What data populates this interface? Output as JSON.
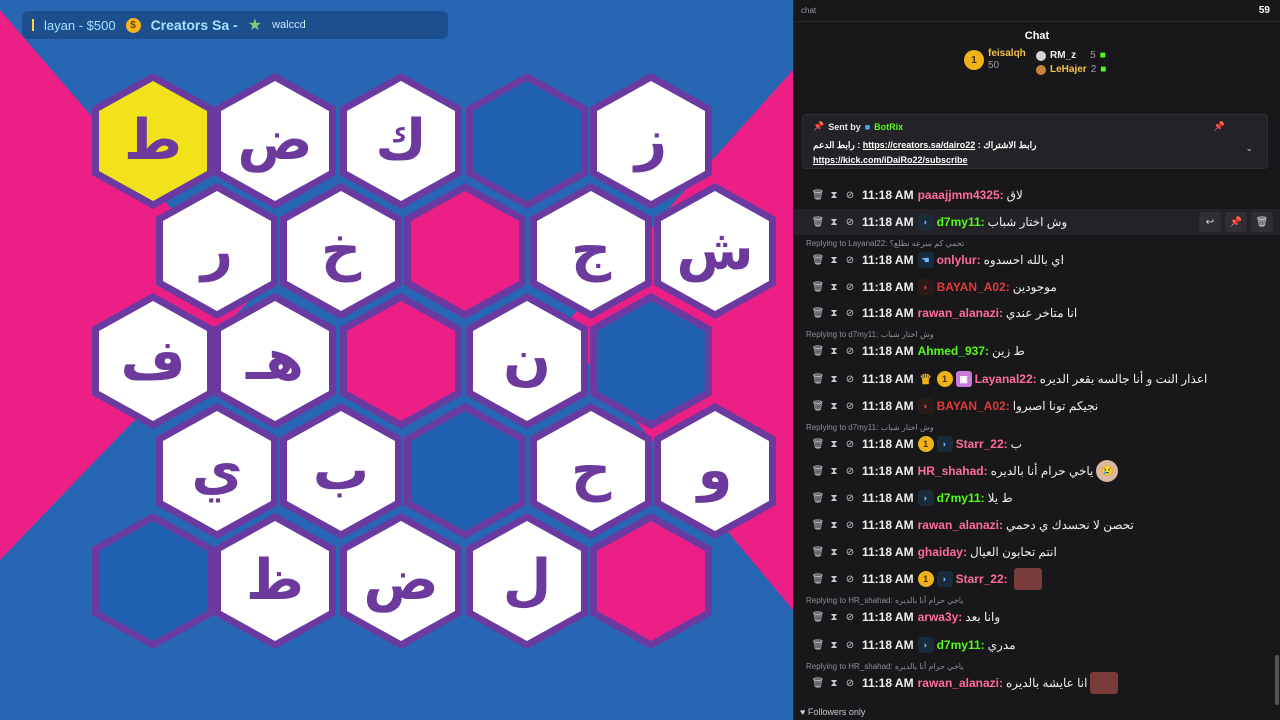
{
  "ticker": {
    "item1": "layan - $500",
    "item2": "Creators Sa -",
    "item3": "walccd",
    "coin": "$"
  },
  "board": {
    "tiles": [
      {
        "letter": "ط",
        "color": "yellow"
      },
      {
        "letter": "ض",
        "color": "white"
      },
      {
        "letter": "ك",
        "color": "white"
      },
      {
        "letter": "",
        "color": "blue"
      },
      {
        "letter": "ز",
        "color": "white"
      },
      {
        "letter": "ر",
        "color": "white"
      },
      {
        "letter": "خ",
        "color": "white"
      },
      {
        "letter": "",
        "color": "pink"
      },
      {
        "letter": "ج",
        "color": "white"
      },
      {
        "letter": "ش",
        "color": "white"
      },
      {
        "letter": "ف",
        "color": "white"
      },
      {
        "letter": "هـ",
        "color": "white"
      },
      {
        "letter": "",
        "color": "pink"
      },
      {
        "letter": "ن",
        "color": "white"
      },
      {
        "letter": "",
        "color": "blue"
      },
      {
        "letter": "ي",
        "color": "white"
      },
      {
        "letter": "ب",
        "color": "white"
      },
      {
        "letter": "",
        "color": "blue"
      },
      {
        "letter": "ح",
        "color": "white"
      },
      {
        "letter": "و",
        "color": "white"
      },
      {
        "letter": "",
        "color": "blue"
      },
      {
        "letter": "ظ",
        "color": "white"
      },
      {
        "letter": "ض",
        "color": "white"
      },
      {
        "letter": "ل",
        "color": "white"
      },
      {
        "letter": "",
        "color": "pink"
      }
    ]
  },
  "chat": {
    "top_label": "chat",
    "viewer_count": "59",
    "title": "Chat",
    "leaders": [
      {
        "rank": "1",
        "name": "feisalqh",
        "count": "50"
      },
      {
        "name": "RM_z",
        "count": "5"
      },
      {
        "name": "LeHajer",
        "count": "2"
      }
    ],
    "pinned": {
      "sent_by": "Sent by",
      "bot": "BotRix",
      "line1_label": "رابط الاشتراك",
      "line1_link": "https://creators.sa/dairo22",
      "line1_label2": "رابط الدعم",
      "line2_link": "https://kick.com/iDaiRo22/subscribe"
    },
    "messages": [
      {
        "time": "11:18 AM",
        "user": "paaajjmm4325",
        "color": "#ff6b9a",
        "text": "لاق",
        "badges": []
      },
      {
        "time": "11:18 AM",
        "user": "d7my11",
        "color": "#53fc18",
        "text": "وش اختار شباب",
        "badges": [
          "sub"
        ],
        "highlight": true
      },
      {
        "reply": "Replying to Layanal22: تحمي كم سرعه نطلع؟"
      },
      {
        "time": "11:18 AM",
        "user": "onlylur",
        "color": "#ff6b9a",
        "text": "اي بالله احسدوه",
        "badges": [
          "hand"
        ]
      },
      {
        "time": "11:18 AM",
        "user": "BAYAN_A02",
        "color": "#e03a3a",
        "text": "موجودين",
        "badges": [
          "red"
        ]
      },
      {
        "time": "11:18 AM",
        "user": "rawan_alanazi",
        "color": "#ff6b9a",
        "text": "انا متاخر عندي",
        "badges": []
      },
      {
        "reply": "Replying to d7my11: وش اختار شباب"
      },
      {
        "time": "11:18 AM",
        "user": "Ahmed_937",
        "color": "#53fc18",
        "text": "ط زين",
        "badges": []
      },
      {
        "time": "11:18 AM",
        "user": "Layanal22",
        "color": "#ff6b9a",
        "text": "اعذار النت و أنا جالسه بقعر الديره",
        "badges": [
          "crown",
          "gold",
          "gift"
        ]
      },
      {
        "time": "11:18 AM",
        "user": "BAYAN_A02",
        "color": "#e03a3a",
        "text": "نجيكم تونا اصبروا",
        "badges": [
          "red"
        ]
      },
      {
        "reply": "Replying to d7my11: وش اختار شباب"
      },
      {
        "time": "11:18 AM",
        "user": "Starr_22",
        "color": "#ff6b9a",
        "text": "ب",
        "badges": [
          "gold",
          "sub"
        ]
      },
      {
        "time": "11:18 AM",
        "user": "HR_shahad",
        "color": "#ff6b9a",
        "text": "ياخي حرام أنا بالديره",
        "badges": [],
        "emote": true
      },
      {
        "time": "11:18 AM",
        "user": "d7my11",
        "color": "#53fc18",
        "text": "ط يلا",
        "badges": [
          "sub"
        ]
      },
      {
        "time": "11:18 AM",
        "user": "rawan_alanazi",
        "color": "#ff6b9a",
        "text": "تحصن لا نحسدك ي دحمي",
        "badges": []
      },
      {
        "time": "11:18 AM",
        "user": "ghaiday",
        "color": "#ff6b9a",
        "text": "انتم تحابون العيال",
        "badges": []
      },
      {
        "time": "11:18 AM",
        "user": "Starr_22",
        "color": "#ff6b9a",
        "text": "",
        "badges": [
          "gold",
          "sub"
        ],
        "emote_sq": true
      },
      {
        "reply": "Replying to HR_shahad: ياخي حرام أنا بالديره"
      },
      {
        "time": "11:18 AM",
        "user": "arwa3y",
        "color": "#ff6b9a",
        "text": "وانا بعد",
        "badges": []
      },
      {
        "time": "11:18 AM",
        "user": "d7my11",
        "color": "#53fc18",
        "text": "مدري",
        "badges": [
          "sub"
        ]
      },
      {
        "reply": "Replying to HR_shahad: ياخي حرام أنا بالديره"
      },
      {
        "time": "11:18 AM",
        "user": "rawan_alanazi",
        "color": "#ff6b9a",
        "text": "انا عايشه بالديره",
        "badges": [],
        "emote_sq": true
      }
    ],
    "footer": "Followers only"
  }
}
